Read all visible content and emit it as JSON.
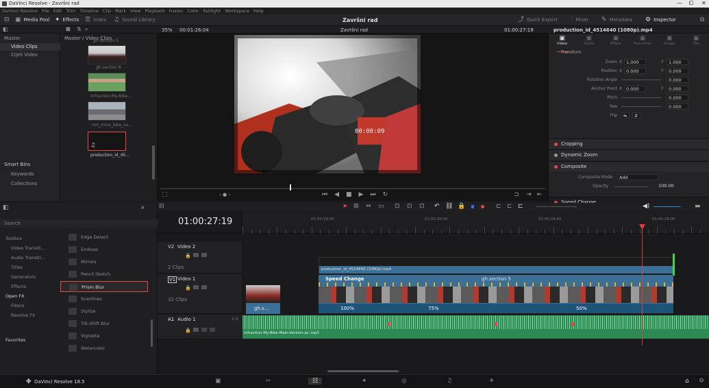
{
  "window": {
    "title": "DaVinci Resolve - Završni rad",
    "min": "—",
    "max": "⧠",
    "close": "✕"
  },
  "menu": [
    "DaVinci Resolve",
    "File",
    "Edit",
    "Trim",
    "Timeline",
    "Clip",
    "Mark",
    "View",
    "Playback",
    "Fusion",
    "Color",
    "Fairlight",
    "Workspace",
    "Help"
  ],
  "toolbar": {
    "media_pool": "Media Pool",
    "effects": "Effects",
    "index": "Index",
    "sound_library": "Sound Library",
    "project_title": "Završni rad",
    "quick_export": "Quick Export",
    "mixer": "Mixer",
    "metadata": "Metadata",
    "inspector": "Inspector"
  },
  "subtool": {
    "zoom": "35%",
    "source_tc": "00:01:26:04",
    "timeline_name": "Završni rad",
    "record_tc": "01:00:27:19",
    "clip_name": "production_id_4514640 (1080p).mp4"
  },
  "bins": {
    "master": "Master",
    "video_clips": "Video Clips",
    "cijeli_video": "Cijeli Video",
    "smart_bins": "Smart Bins",
    "keywords": "Keywords",
    "collections": "Collections"
  },
  "pool": {
    "path": "Master / Video Clips",
    "clips": [
      "gh.section 5",
      "gh.section 6",
      "Infraction-My-Bike...",
      "not_mine_bike_se...",
      "production_id_45..."
    ]
  },
  "viewer": {
    "overlay_tc": "00:00:09"
  },
  "inspector": {
    "tabs": [
      "Video",
      "Audio",
      "Effect",
      "Transition",
      "Image",
      "File"
    ],
    "transform": "Transform",
    "rows": [
      {
        "label": "Zoom",
        "x": "1.000",
        "y": "1.000"
      },
      {
        "label": "Position",
        "x": "0.000",
        "y": "0.000"
      },
      {
        "label": "Rotation Angle",
        "v": "0.000"
      },
      {
        "label": "Anchor Point",
        "x": "0.000",
        "y": "0.000"
      },
      {
        "label": "Pitch",
        "v": "0.000"
      },
      {
        "label": "Yaw",
        "v": "0.000"
      },
      {
        "label": "Flip"
      }
    ],
    "x_label": "X",
    "y_label": "Y",
    "cropping": "Cropping",
    "dynamic_zoom": "Dynamic Zoom",
    "composite": "Composite",
    "composite_mode_label": "Composite Mode",
    "composite_mode": "Add",
    "opacity_label": "Opacity",
    "opacity": "100.00",
    "speed_change": "Speed Change"
  },
  "effects": {
    "search": "Search",
    "categories": [
      "Toolbox",
      "Video Transiti...",
      "Audio Transiti...",
      "Titles",
      "Generators",
      "Effects",
      "Open FX",
      "Filters",
      "Resolve FX"
    ],
    "favorites": "Favorites",
    "items": [
      "Edge Detect",
      "Emboss",
      "Mirrors",
      "Pencil Sketch",
      "Prism Blur",
      "Scanlines",
      "Stylize",
      "Tilt-Shift Blur",
      "Vignette",
      "Watercolor"
    ]
  },
  "timeline": {
    "timecode": "01:00:27:19",
    "ruler": [
      "01:00:16:00",
      "01:00:20:00",
      "01:00:24:00",
      "01:00:28:00"
    ],
    "v2": {
      "id": "V2",
      "name": "Video 2",
      "clips": "2 Clips"
    },
    "v1": {
      "id": "V1",
      "name": "Video 1",
      "clips": "32 Clips"
    },
    "a1": {
      "id": "A1",
      "name": "Audio 1",
      "level": "2.0"
    },
    "v2_clip": "production_id_4514640 (1080p).mp4",
    "speed_change": "Speed Change",
    "section_label": "gh.section 5",
    "small_clip": "gh.s...",
    "speeds": [
      "100%",
      "75%",
      "50%"
    ],
    "audio_clip": "Infraction-My-Bike-Main-Version-pr..mp3"
  },
  "app": {
    "name": "DaVinci Resolve 18.5"
  },
  "colors": {
    "accent": "#e34a4a",
    "v1_clip": "#3b6f96",
    "audio": "#2e8a55",
    "playhead": "#e33a3a"
  }
}
